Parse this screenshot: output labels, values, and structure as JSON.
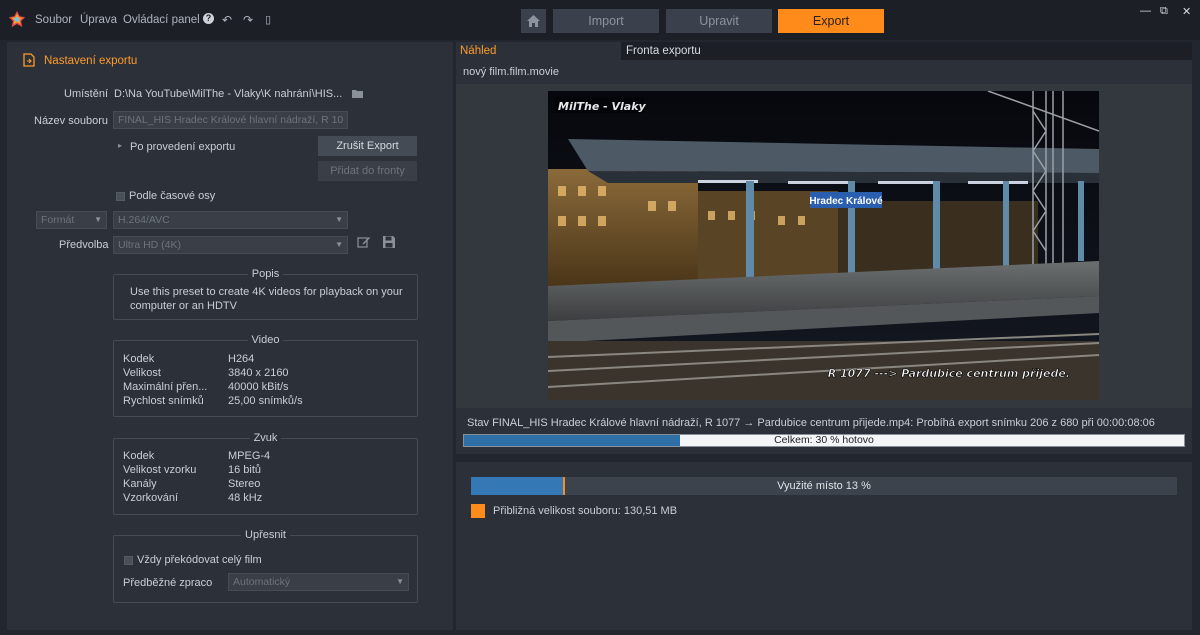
{
  "titlebar": {
    "menu": [
      "Soubor",
      "Úprava",
      "Ovládací panel"
    ],
    "wizard": {
      "import": "Import",
      "edit": "Upravit",
      "export": "Export"
    },
    "window_controls": {
      "minimize": "—",
      "restore": "⧉",
      "close": "✕"
    }
  },
  "export_settings": {
    "title": "Nastavení exportu",
    "location_label": "Umístění",
    "location_value": "D:\\Na YouTube\\MilThe - Vlaky\\K nahrání\\HIS...",
    "filename_label": "Název souboru",
    "filename_value": "FINAL_HIS Hradec Králové hlavní nádraží, R 10",
    "after_export_label": "Po provedení exportu",
    "cancel_export": "Zrušit Export",
    "add_to_queue": "Přidat do fronty",
    "timeline_label": "Podle časové osy",
    "format_label": "Formát",
    "format_value": "H.264/AVC",
    "preset_label": "Předvolba",
    "preset_value": "Ultra HD (4K)",
    "description": {
      "title": "Popis",
      "text": "Use this preset to create 4K videos for playback on your computer or an HDTV"
    },
    "video": {
      "title": "Video",
      "rows": [
        {
          "k": "Kodek",
          "v": "H264"
        },
        {
          "k": "Velikost",
          "v": "3840 x 2160"
        },
        {
          "k": "Maximální přen...",
          "v": "40000 kBit/s"
        },
        {
          "k": "Rychlost snímků",
          "v": "25,00 snímků/s"
        }
      ]
    },
    "audio": {
      "title": "Zvuk",
      "rows": [
        {
          "k": "Kodek",
          "v": "MPEG-4"
        },
        {
          "k": "Velikost vzorku",
          "v": "16 bitů"
        },
        {
          "k": "Kanály",
          "v": "Stereo"
        },
        {
          "k": "Vzorkování",
          "v": "48 kHz"
        }
      ]
    },
    "refine": {
      "title": "Upřesnit",
      "always_transcode": "Vždy překódovat celý film",
      "prerender_label": "Předběžné zpraco",
      "prerender_value": "Automatický"
    }
  },
  "tabs": {
    "preview": "Náhled",
    "queue": "Fronta exportu"
  },
  "preview": {
    "movie_title": "nový film.film.movie",
    "watermark": "MilThe - Vlaky",
    "station_sign": "Hradec Králové",
    "caption": "R 1077 ---> Pardubice centrum přijede."
  },
  "status": {
    "text": "Stav FINAL_HIS Hradec Králové hlavní nádraží, R 1077 → Pardubice centrum přijede.mp4: Probíhá export snímku 206 z 680 při 00:00:08:06",
    "progress_label": "Celkem: 30 % hotovo",
    "progress_fraction": 0.3
  },
  "disk": {
    "label": "Využité místo 13 %",
    "used_fraction": 0.13,
    "estimated_fraction": 0.131,
    "size_label": "Přibližná velikost souboru: 130,51 MB"
  },
  "colors": {
    "accent": "#ff8c1a",
    "progress": "#2f6fa8",
    "disk": "#3478b5"
  }
}
